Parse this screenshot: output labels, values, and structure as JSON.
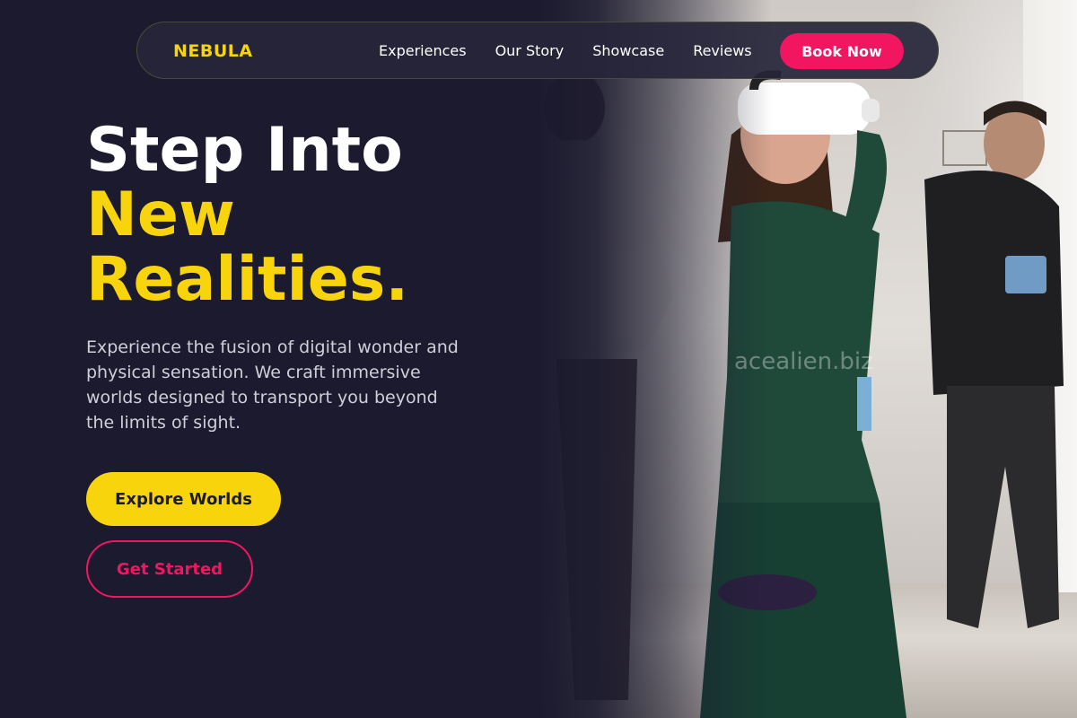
{
  "colors": {
    "background": "#1b1a2e",
    "accent_yellow": "#f7d40c",
    "accent_pink": "#f21560",
    "text_muted": "#d0cfd9"
  },
  "nav": {
    "logo": "NEBULA",
    "links": [
      "Experiences",
      "Our Story",
      "Showcase",
      "Reviews"
    ],
    "cta": "Book Now"
  },
  "hero": {
    "title_line1": "Step Into",
    "title_line2": "New",
    "title_line3": "Realities.",
    "description": "Experience the fusion of digital wonder and physical sensation. We craft immersive worlds designed to transport you beyond the limits of sight.",
    "primary_button": "Explore Worlds",
    "secondary_button": "Get Started"
  },
  "photo": {
    "subject": "woman-wearing-vr-headset",
    "watermark": "acealien.biz"
  }
}
